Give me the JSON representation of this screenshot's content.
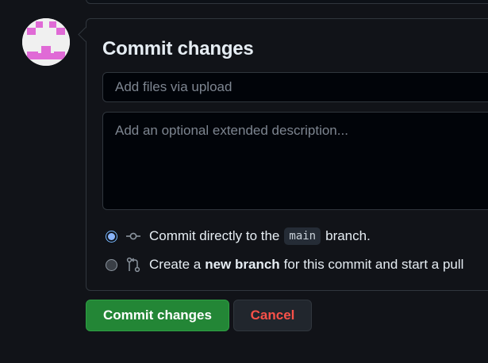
{
  "form": {
    "title": "Commit changes",
    "summary_placeholder": "Add files via upload",
    "summary_value": "",
    "description_placeholder": "Add an optional extended description...",
    "description_value": ""
  },
  "options": {
    "direct": {
      "selected": true,
      "icon": "git-commit-icon",
      "text_before": "Commit directly to the",
      "branch": "main",
      "text_after": "branch."
    },
    "new_branch": {
      "selected": false,
      "icon": "git-pull-request-icon",
      "text_before": "Create a",
      "bold": "new branch",
      "text_after": "for this commit and start a pull"
    }
  },
  "actions": {
    "commit_label": "Commit changes",
    "cancel_label": "Cancel"
  },
  "colors": {
    "primary_button": "#238636",
    "cancel_text": "#f85149",
    "avatar_pattern": "#e06ad6"
  }
}
